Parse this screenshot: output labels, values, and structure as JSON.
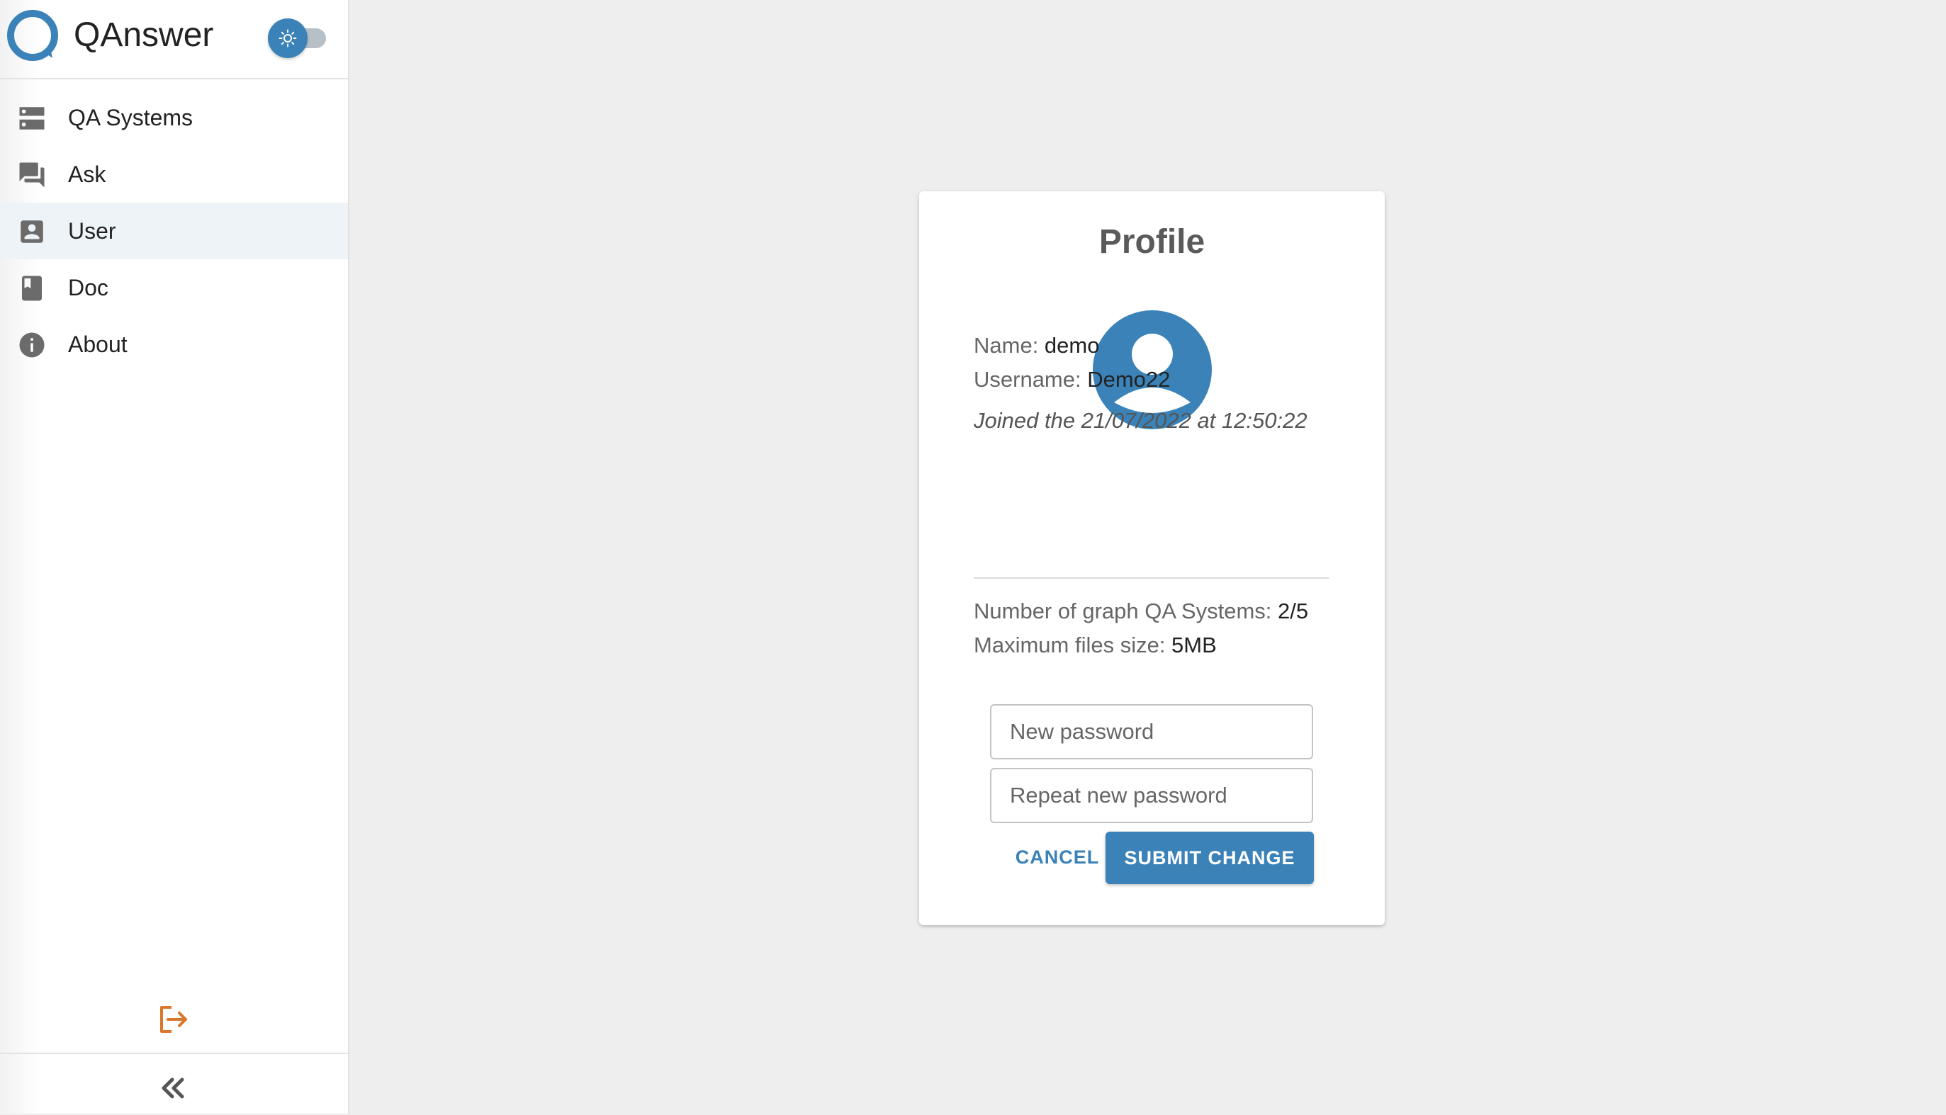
{
  "app": {
    "name": "QAnswer",
    "brand_color": "#3a82b8",
    "theme_toggle_state": "light"
  },
  "sidebar": {
    "items": [
      {
        "label": "QA Systems",
        "icon": "server-icon",
        "active": false
      },
      {
        "label": "Ask",
        "icon": "chat-bubbles-icon",
        "active": false
      },
      {
        "label": "User",
        "icon": "account-box-icon",
        "active": true
      },
      {
        "label": "Doc",
        "icon": "book-icon",
        "active": false
      },
      {
        "label": "About",
        "icon": "info-icon",
        "active": false
      }
    ],
    "logout_icon": "logout-icon",
    "logout_color": "#d9772b",
    "collapse_icon": "double-chevron-left-icon"
  },
  "profile": {
    "title": "Profile",
    "avatar_icon": "account-circle-icon",
    "name_label": "Name: ",
    "name_value": "demo",
    "username_label": "Username: ",
    "username_value": "Demo22",
    "joined": "Joined the 21/07/2022 at 12:50:22",
    "qa_systems_label": "Number of graph QA Systems: ",
    "qa_systems_value": "2/5",
    "max_files_label": "Maximum files size: ",
    "max_files_value": "5MB",
    "new_password_placeholder": "New password",
    "new_password_value": "",
    "repeat_password_placeholder": "Repeat new password",
    "repeat_password_value": "",
    "cancel_label": "CANCEL",
    "submit_label": "SUBMIT CHANGE"
  }
}
